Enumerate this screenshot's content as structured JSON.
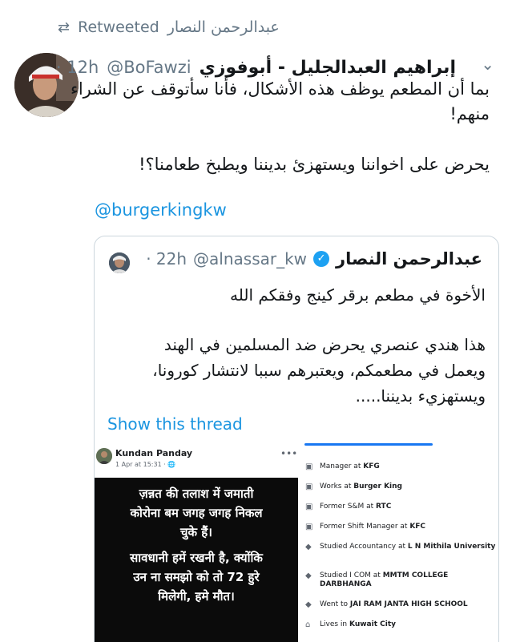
{
  "retweet": {
    "label": "Retweeted",
    "retweeter": "عبدالرحمن النصار"
  },
  "tweet": {
    "author_name": "إبراهيم العبدالجليل - أبوفوزي",
    "author_handle": "@BoFawzi",
    "time": "· 12h",
    "lines": [
      "بما أن المطعم يوظف هذه الأشكال، فأنا سأتوقف عن الشراء",
      "منهم!",
      "يحرض على اخواننا ويستهزئ بديننا ويطبخ طعامنا؟!"
    ],
    "mention": "@burgerkingkw"
  },
  "quoted": {
    "author_name": "عبدالرحمن النصار",
    "author_handle": "@alnassar_kw",
    "time": "· 22h",
    "lines": [
      "الأخوة في مطعم برقر كينج وفقكم الله",
      "هذا هندي عنصري يحرض ضد المسلمين في الهند",
      "ويعمل في مطعمكم، ويعتبرهم سببا لانتشار كورونا،",
      "ويستهزيء بديننا....."
    ],
    "show_thread": "Show this thread"
  },
  "facebook_post": {
    "name": "Kundan Panday",
    "meta": "1 Apr at 15:31 · 🌐",
    "image_text": [
      "ज़न्नत की तलाश में जमाती",
      "कोरोना बम जगह जगह निकल",
      "चुके हैं।",
      "सावधानी हमें रखनी है, क्योंकि",
      "उन ना समझो को तो 72 हुरे",
      "मिलेगी, हमे मौत।"
    ],
    "profile_items": [
      {
        "icon": "briefcase-icon",
        "prefix": "Manager at ",
        "bold": "KFG"
      },
      {
        "icon": "briefcase-icon",
        "prefix": "Works at ",
        "bold": "Burger King"
      },
      {
        "icon": "briefcase-icon",
        "prefix": "Former S&M at ",
        "bold": "RTC"
      },
      {
        "icon": "briefcase-icon",
        "prefix": "Former Shift Manager at ",
        "bold": "KFC"
      },
      {
        "icon": "graduation-cap-icon",
        "prefix": "Studied Accountancy at ",
        "bold": "L N Mithila University"
      },
      {
        "icon": "graduation-cap-icon",
        "prefix": "Studied I COM at ",
        "bold": "MMTM COLLEGE DARBHANGA"
      },
      {
        "icon": "graduation-cap-icon",
        "prefix": "Went to ",
        "bold": "JAI RAM JANTA HIGH SCHOOL"
      },
      {
        "icon": "home-icon",
        "prefix": "Lives in ",
        "bold": "Kuwait City"
      }
    ]
  },
  "colors": {
    "link": "#1b95e0",
    "muted": "#657786",
    "verified": "#1da1f2"
  }
}
